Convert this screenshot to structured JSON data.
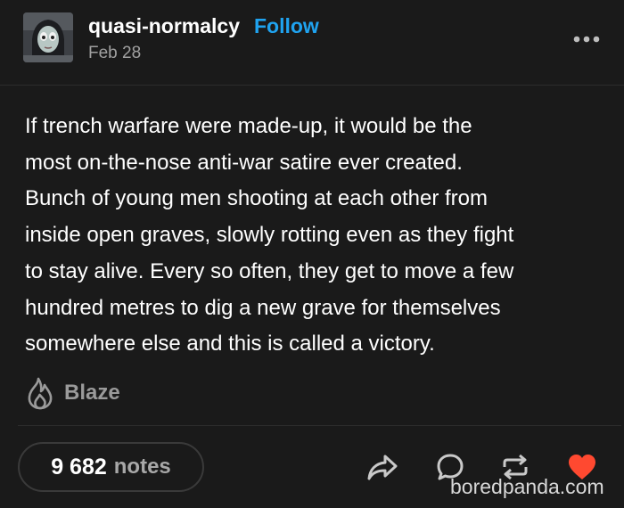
{
  "post": {
    "username": "quasi-normalcy",
    "follow_label": "Follow",
    "date": "Feb 28",
    "more_icon": "more-horizontal-icon",
    "body_lines": [
      "If trench warfare were made-up, it would be the",
      "most on-the-nose anti-war satire ever created.",
      "Bunch of young men shooting at each other from",
      "inside open graves, slowly rotting even as they fight",
      "to stay alive. Every so often, they get to move a few",
      "hundred metres to dig a new grave for themselves",
      "somewhere else and this is called a victory."
    ],
    "blaze_label": "Blaze",
    "blaze_icon": "flame-icon"
  },
  "footer": {
    "notes_count": "9 682",
    "notes_label": "notes",
    "actions": [
      "share-icon",
      "reply-icon",
      "reblog-icon",
      "heart-icon"
    ],
    "liked": true
  },
  "colors": {
    "background": "#1a1a1a",
    "text": "#ffffff",
    "follow": "#1fa3f0",
    "muted": "#a0a0a0",
    "heart": "#ff4930"
  },
  "watermark": "boredpanda.com"
}
